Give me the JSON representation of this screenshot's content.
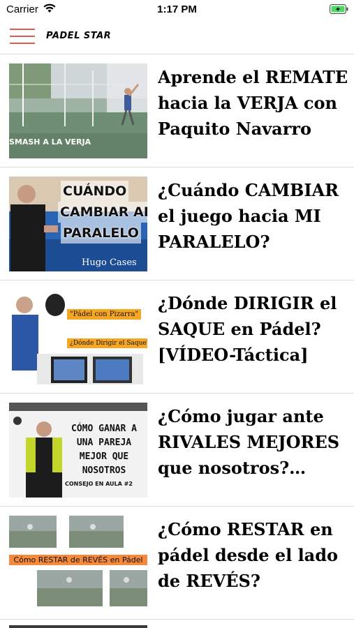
{
  "status_bar": {
    "carrier": "Carrier",
    "time": "1:17 PM",
    "icons": [
      "wifi-icon",
      "battery-charging-icon"
    ]
  },
  "nav": {
    "menu_icon": "hamburger-menu-icon",
    "title": "PADEL STAR",
    "accent_color": "#e25a4e"
  },
  "articles": [
    {
      "title": "Aprende el REMATE hacia la VERJA con Paquito Navarro",
      "thumb_text": "SMASH A LA VERJA"
    },
    {
      "title": "¿Cuándo CAMBIAR el juego hacia MI PARALELO?",
      "thumb_lines": [
        "CUÁNDO",
        "CAMBIAR AL",
        "PARALELO"
      ],
      "thumb_caption": "Hugo Cases"
    },
    {
      "title": "¿Dónde DIRIGIR el SAQUE en Pádel? [VÍDEO-Táctica]",
      "thumb_tag1": "\"Pádel con Pizarra\"",
      "thumb_tag2": "¿Dónde Dirigir el Saque?"
    },
    {
      "title": "¿Cómo jugar ante RIVALES MEJORES que nosotros? Cons...",
      "thumb_lines": [
        "CÓMO GANAR A",
        "UNA PAREJA",
        "MEJOR QUE",
        "NOSOTROS"
      ],
      "thumb_caption": "CONSEJO EN AULA #2"
    },
    {
      "title": "¿Cómo RESTAR en pádel desde el lado de REVÉS?",
      "thumb_banner": "Cómo RESTAR de REVÉS en Pádel"
    }
  ]
}
